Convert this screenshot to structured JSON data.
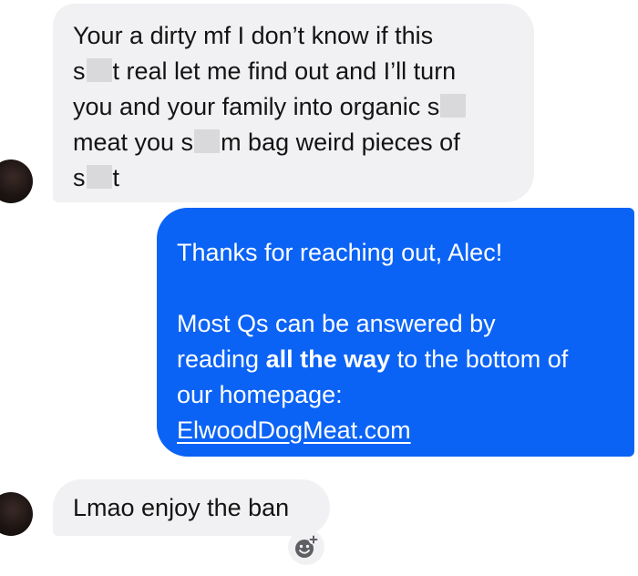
{
  "conversation": {
    "incoming_1": {
      "lines": [
        "Your a dirty mf I don’t know if this",
        [
          "s",
          "t real let me find out and I’ll turn"
        ],
        [
          "you and your family into organic s",
          ""
        ],
        [
          "meat you s",
          "m bag weird pieces of"
        ],
        [
          "s",
          "t"
        ]
      ]
    },
    "outgoing": {
      "greeting": "Thanks for reaching out, Alec!",
      "body_1": "Most Qs can be answered by",
      "body_2_pre": "reading ",
      "body_2_bold": "all the way",
      "body_2_post": " to the bottom of",
      "body_3": "our homepage:",
      "link": "ElwoodDogMeat.com",
      "bubble_color": "#0b63f6"
    },
    "incoming_2": {
      "text": "Lmao enjoy the ban"
    },
    "icons": {
      "reaction": "add-reaction-icon"
    },
    "colors": {
      "incoming_bubble": "#f1f1f3",
      "censor_block": "#d9d9db"
    }
  }
}
